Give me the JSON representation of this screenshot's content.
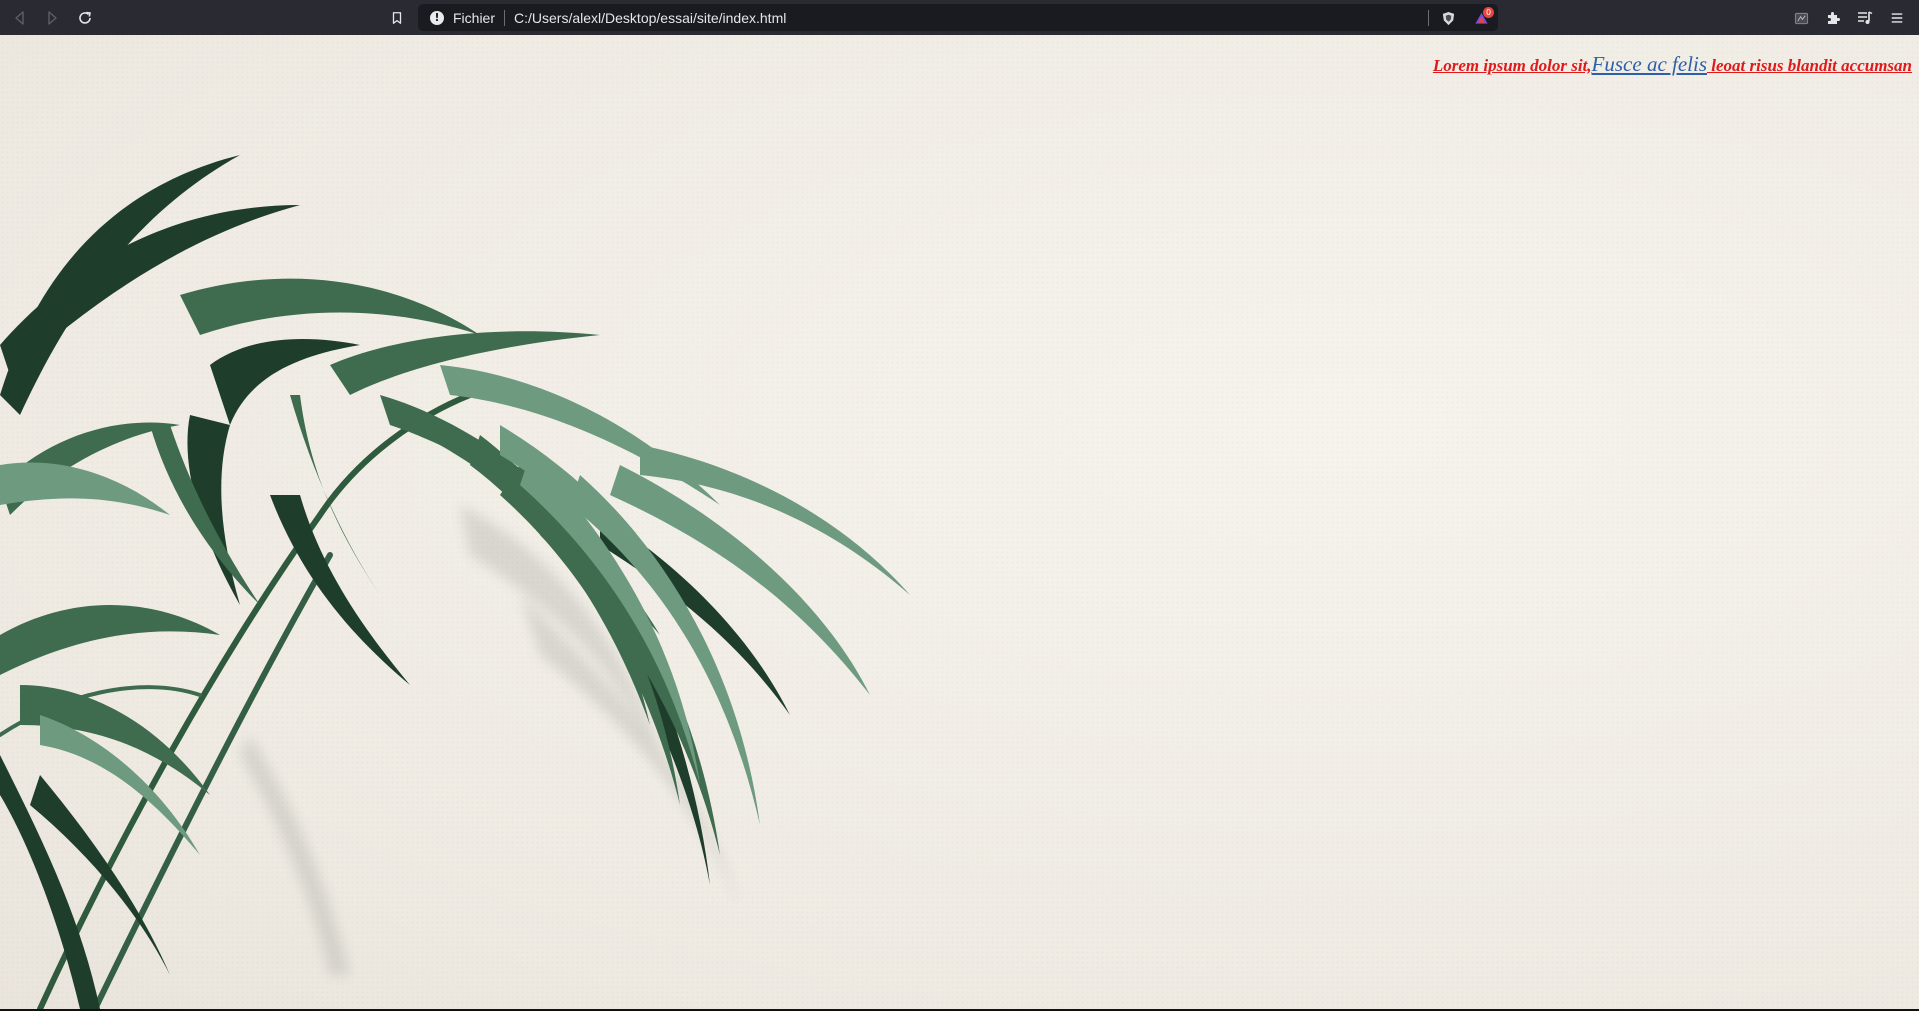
{
  "browser": {
    "scheme_label": "Fichier",
    "url": "C:/Users/alexl/Desktop/essai/site/index.html",
    "rewards_badge": "0",
    "icons": {
      "back": "back-arrow-icon",
      "forward": "forward-arrow-icon",
      "reload": "reload-icon",
      "bookmark": "bookmark-icon",
      "info": "info-icon",
      "shield": "brave-shield-icon",
      "rewards": "brave-rewards-icon",
      "wallet": "wallet-icon",
      "extensions": "puzzle-icon",
      "reading_list": "playlist-icon",
      "menu": "hamburger-menu-icon"
    }
  },
  "page": {
    "headline_part1": "Lorem ipsum dolor sit,",
    "headline_link": "Fusce ac felis",
    "headline_part2": " leoat risus blandit accumsan",
    "colors": {
      "headline_red": "#e01a1a",
      "link_blue": "#2e5fa8",
      "wall": "#f3efe8",
      "leaf_dark": "#1f3d2b",
      "leaf_mid": "#3f6b4f",
      "leaf_light": "#6e9a80"
    },
    "background_image": "palm-leaves-on-white-wall"
  }
}
